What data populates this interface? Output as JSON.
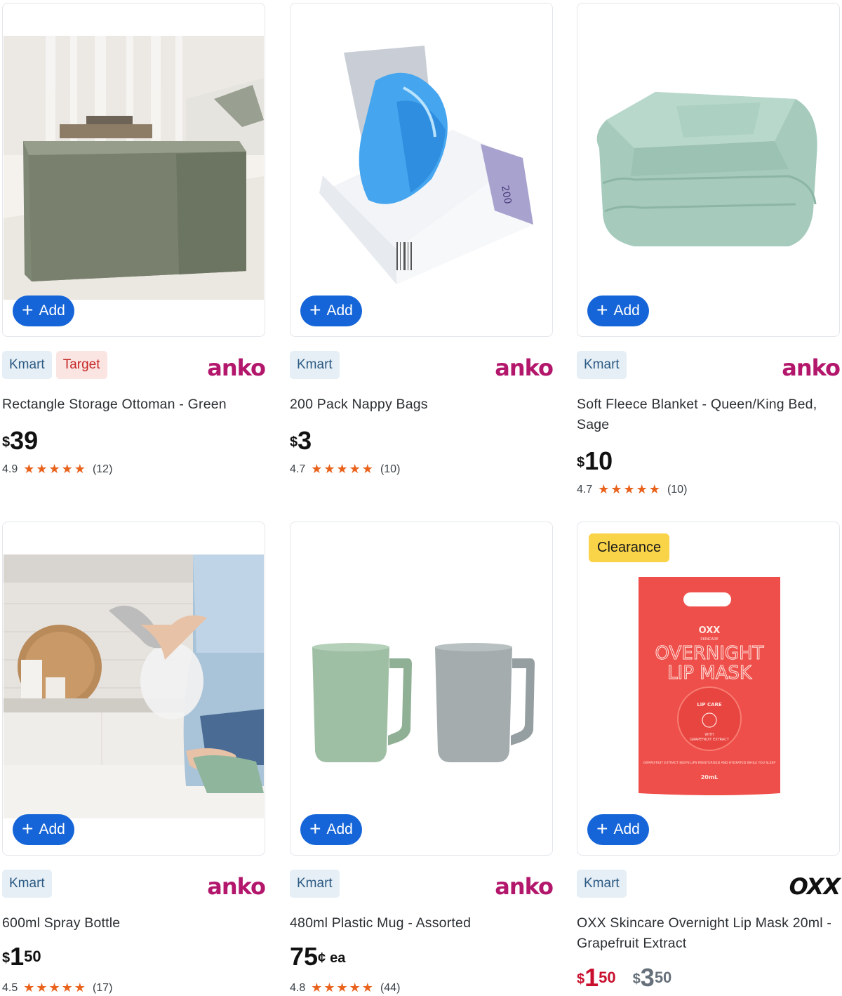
{
  "add_label": "Add",
  "products": [
    {
      "tags": [
        "Kmart",
        "Target"
      ],
      "brand": "anko",
      "title": "Rectangle Storage Ottoman - Green",
      "price_dollars": "39",
      "rating": "4.9",
      "stars": "★★★★★",
      "reviews": "(12)"
    },
    {
      "tags": [
        "Kmart"
      ],
      "brand": "anko",
      "title": "200 Pack Nappy Bags",
      "price_dollars": "3",
      "rating": "4.7",
      "stars": "★★★★★",
      "reviews": "(10)",
      "box_text": "200"
    },
    {
      "tags": [
        "Kmart"
      ],
      "brand": "anko",
      "title": "Soft Fleece Blanket - Queen/King Bed, Sage",
      "price_dollars": "10",
      "rating": "4.7",
      "stars": "★★★★★",
      "reviews": "(10)"
    },
    {
      "tags": [
        "Kmart"
      ],
      "brand": "anko",
      "title": "600ml Spray Bottle",
      "price_dollars": "1",
      "price_cents": "50",
      "rating": "4.5",
      "stars": "★★★★★",
      "reviews": "(17)"
    },
    {
      "tags": [
        "Kmart"
      ],
      "brand": "anko",
      "title": "480ml Plastic Mug - Assorted",
      "price_cents_only": "75",
      "cent_symbol": "¢",
      "unit": "ea",
      "rating": "4.8",
      "stars": "★★★★★",
      "reviews": "(44)"
    },
    {
      "badge": "Clearance",
      "tags": [
        "Kmart"
      ],
      "brand": "OXX",
      "title": "OXX Skincare Overnight Lip Mask 20ml - Grapefruit Extract",
      "price_dollars": "1",
      "price_cents": "50",
      "old_price_dollars": "3",
      "old_price_cents": "50",
      "pack": {
        "brand": "OXX",
        "sub": "SKINCARE",
        "line1": "OVERNIGHT",
        "line2": "LIP MASK",
        "care": "LIP CARE",
        "with": "WITH",
        "extract": "GRAPEFRUIT EXTRACT",
        "desc": "GRAPEFRUIT EXTRACT KEEPS LIPS MOISTURISED AND HYDRATED WHILE YOU SLEEP",
        "size": "20mL"
      }
    }
  ],
  "colors": {
    "add_button": "#1565d8",
    "anko": "#b3176c",
    "star": "#e9621c",
    "sale_price": "#c8102e",
    "clearance_badge": "#f9d448"
  }
}
